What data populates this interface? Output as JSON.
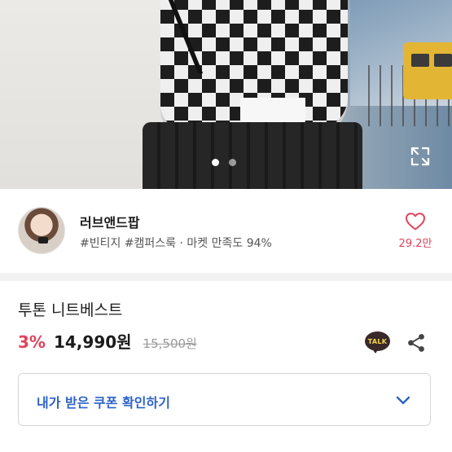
{
  "hero": {
    "pager_dots": [
      {
        "active": true
      },
      {
        "active": false
      }
    ],
    "expand_icon": "expand-arrows-icon"
  },
  "seller": {
    "name": "러브앤드팝",
    "meta": "#빈티지 #캠퍼스룩 · 마켓 만족도 94%",
    "like_icon": "heart-outline-icon",
    "like_count": "29.2만"
  },
  "product": {
    "title": "투톤 니트베스트",
    "discount": "3%",
    "price": "14,990원",
    "original_price": "15,500원",
    "talk_icon_label": "TALK",
    "share_icon": "share-icon"
  },
  "coupon": {
    "label": "내가 받은 쿠폰 확인하기",
    "icon": "chevron-down-icon"
  },
  "colors": {
    "accent_red": "#e1435b",
    "link_blue": "#2d63c8",
    "talk_brown": "#3a2929",
    "talk_yellow": "#f6d84a"
  }
}
